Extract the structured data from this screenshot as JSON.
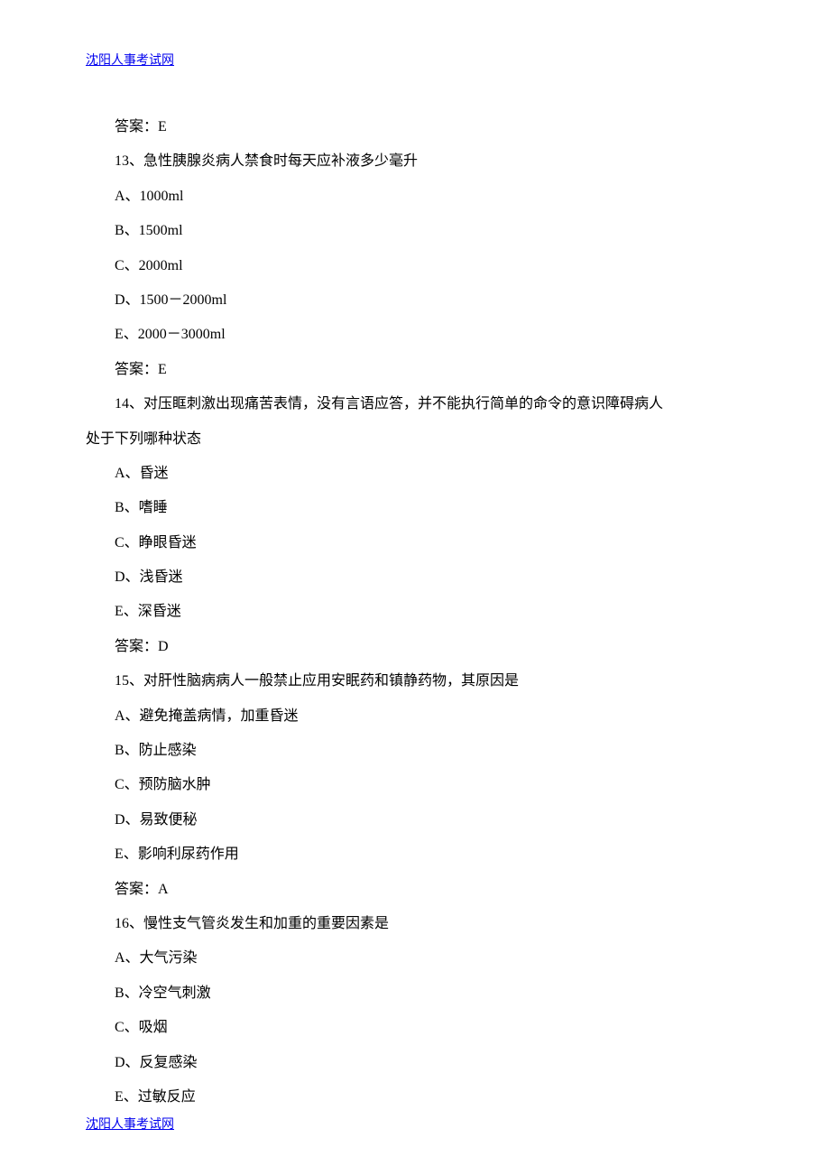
{
  "header_link": "沈阳人事考试网 ",
  "footer_link": "沈阳人事考试网",
  "q12_answer": "答案：E",
  "q13": {
    "stem": "13、急性胰腺炎病人禁食时每天应补液多少毫升",
    "A": "A、1000ml",
    "B": "B、1500ml",
    "C": "C、2000ml",
    "D": "D、1500－2000ml",
    "E": "E、2000－3000ml",
    "answer": "答案：E"
  },
  "q14": {
    "stem_line1": "14、对压眶刺激出现痛苦表情，没有言语应答，并不能执行简单的命令的意识障碍病人",
    "stem_line2": "处于下列哪种状态",
    "A": "A、昏迷",
    "B": "B、嗜睡",
    "C": "C、睁眼昏迷",
    "D": "D、浅昏迷",
    "E": "E、深昏迷",
    "answer": "答案：D"
  },
  "q15": {
    "stem": "15、对肝性脑病病人一般禁止应用安眠药和镇静药物，其原因是",
    "A": "A、避免掩盖病情，加重昏迷",
    "B": "B、防止感染",
    "C": "C、预防脑水肿",
    "D": "D、易致便秘",
    "E": "E、影响利尿药作用",
    "answer": "答案：A"
  },
  "q16": {
    "stem": "16、慢性支气管炎发生和加重的重要因素是",
    "A": "A、大气污染",
    "B": "B、冷空气刺激",
    "C": "C、吸烟",
    "D": "D、反复感染",
    "E": "E、过敏反应"
  }
}
